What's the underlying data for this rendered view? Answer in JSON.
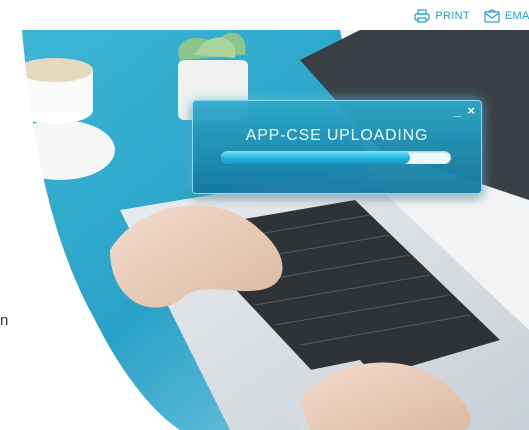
{
  "toolbar": {
    "print_label": "PRINT",
    "email_label": "EMAI",
    "print_icon": "printer-icon",
    "email_icon": "envelope-icon"
  },
  "side_text": "n",
  "dialog": {
    "title": "APP-CSE UPLOADING",
    "minimize_label": "_",
    "close_label": "×",
    "progress_fraction": 0.82
  },
  "colors": {
    "accent": "#1aa3c8",
    "dialog_top": "#2da8c8",
    "dialog_bottom": "#1678a0",
    "progress_fill": "#1fb6e0"
  }
}
